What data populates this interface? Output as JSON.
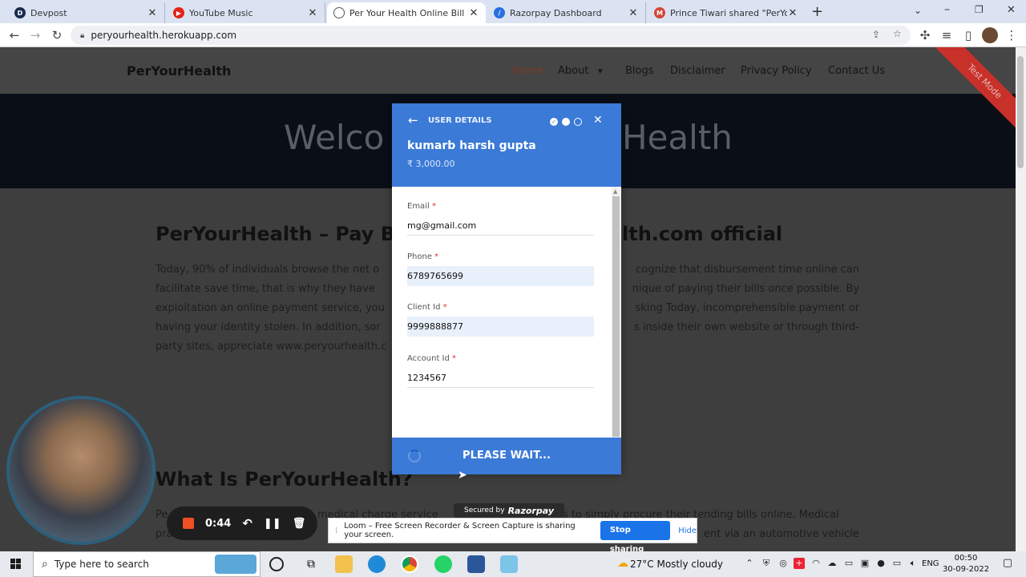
{
  "browser": {
    "tabs": [
      {
        "title": "Devpost",
        "icon": "devpost-icon",
        "color": "#1a2b4f"
      },
      {
        "title": "YouTube Music",
        "icon": "youtube-music-icon",
        "color": "#e62117"
      },
      {
        "title": "Per Your Health Online Bill Payme",
        "icon": "globe-icon",
        "color": "#555555",
        "active": true
      },
      {
        "title": "Razorpay Dashboard",
        "icon": "razorpay-icon",
        "color": "#2b6fe0"
      },
      {
        "title": "Prince Tiwari shared \"PerYourHea",
        "icon": "gmail-icon",
        "color": "#d44638"
      }
    ],
    "url": "peryourhealth.herokuapp.com"
  },
  "site": {
    "logo": "PerYourHealth",
    "nav": [
      "Home",
      "About",
      "Blogs",
      "Disclaimer",
      "Privacy Policy",
      "Contact Us"
    ],
    "hero_left": "Welco",
    "hero_right": "Health",
    "section1_left": "PerYourHealth – Pay B",
    "section1_right": "lth.com official",
    "para1_left": [
      "Today, 90% of individuals browse the net o",
      "facilitate save time, that is why they have",
      "exploitation an online payment service, you",
      "having your identity stolen. In addition, sor",
      "party sites, appreciate www.peryourhealth.c"
    ],
    "para1_right": [
      "cognize that disbursement time online can",
      "nique of paying their bills once possible. By",
      "sking Today, incomprehensible payment or",
      "s inside their own website or through third-",
      ""
    ],
    "section2": "What Is PerYourHealth?",
    "para2_left": "Pe",
    "para2_mid": "medical charge service",
    "para2_right": "s to simply procure their tending bills online. Medical",
    "para3_left": "pra",
    "para3_right": "ent via an automotive vehicle",
    "test_mode": "Test Mode"
  },
  "checkout": {
    "step": "USER DETAILS",
    "name": "kumarb harsh gupta",
    "amount": "₹ 3,000.00",
    "fields": [
      {
        "label": "Email",
        "value": "mg@gmail.com",
        "filled": false
      },
      {
        "label": "Phone",
        "value": "6789765699",
        "filled": true
      },
      {
        "label": "Client Id",
        "value": "9999888877",
        "filled": true
      },
      {
        "label": "Account Id",
        "value": "1234567",
        "filled": false
      }
    ],
    "required_mark": "*",
    "button": "PLEASE WAIT...",
    "secured_prefix": "Secured by",
    "secured_brand": "Razorpay"
  },
  "recorder": {
    "time": "0:44"
  },
  "loom": {
    "message": "Loom – Free Screen Recorder & Screen Capture is sharing your screen.",
    "stop": "Stop sharing",
    "hide": "Hide"
  },
  "taskbar": {
    "search_placeholder": "Type here to search",
    "weather": "27°C  Mostly cloudy",
    "lang": "ENG",
    "time": "00:50",
    "date": "30-09-2022"
  }
}
